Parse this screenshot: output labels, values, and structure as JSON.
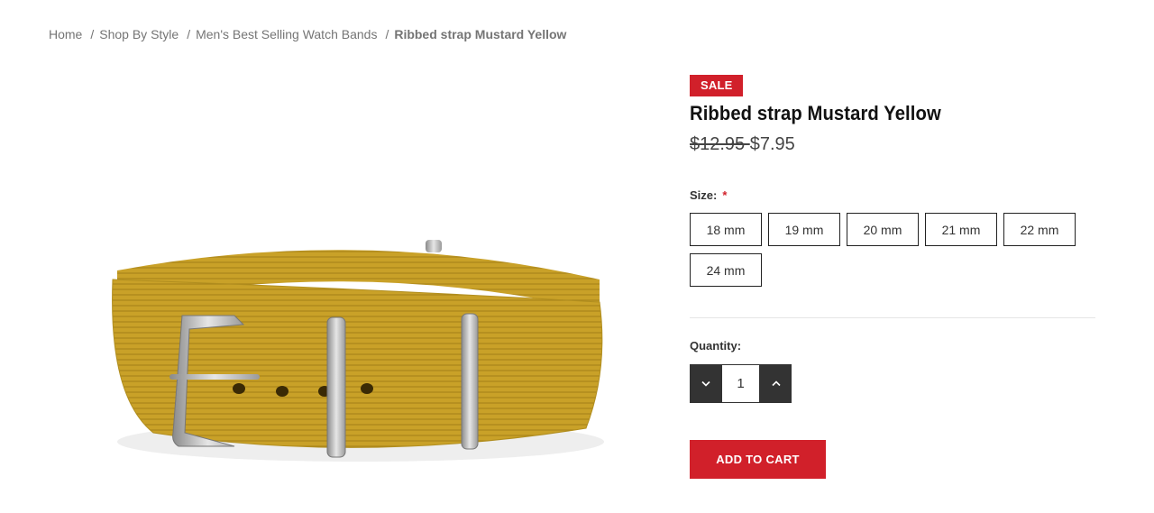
{
  "breadcrumb": {
    "items": [
      "Home",
      "Shop By Style",
      "Men's Best Selling Watch Bands"
    ],
    "current": "Ribbed strap Mustard Yellow"
  },
  "product": {
    "badge": "SALE",
    "title": "Ribbed strap Mustard Yellow",
    "old_price": "$12.95 ",
    "price": "$7.95",
    "image_alt": "Mustard yellow ribbed NATO watch strap"
  },
  "options": {
    "size_label": "Size:",
    "required_mark": "*",
    "sizes": [
      "18 mm",
      "19 mm",
      "20 mm",
      "21 mm",
      "22 mm",
      "24 mm"
    ]
  },
  "quantity": {
    "label": "Quantity:",
    "value": "1",
    "decrease_icon": "chevron-down-icon",
    "increase_icon": "chevron-up-icon"
  },
  "cart": {
    "add_label": "ADD TO CART"
  },
  "colors": {
    "accent": "#d1202a",
    "strap": "#c9a128",
    "dark": "#333333"
  }
}
